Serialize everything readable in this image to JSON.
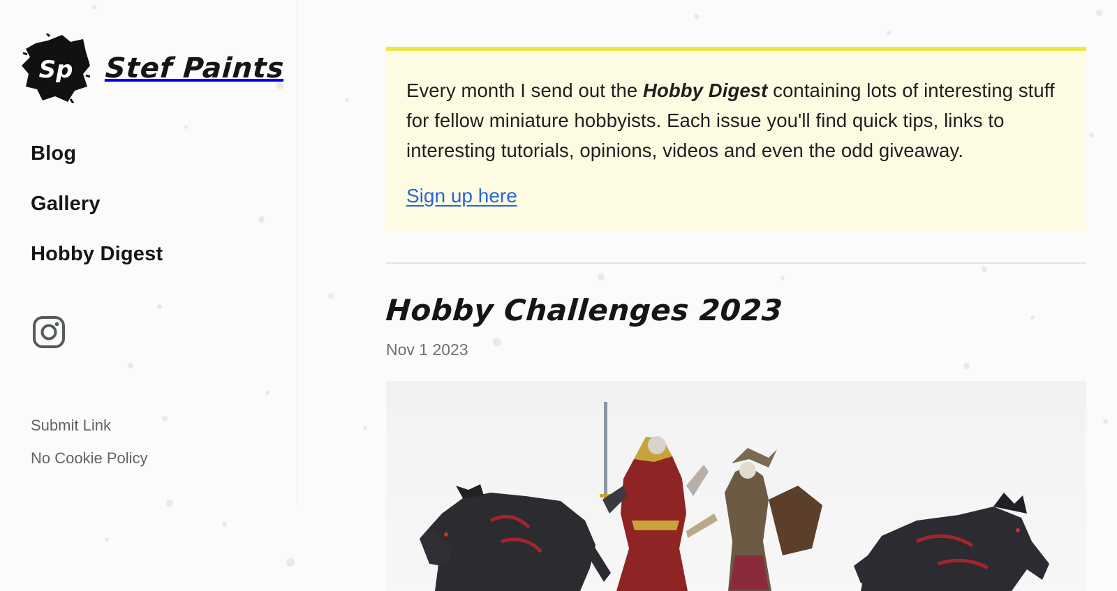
{
  "brand": {
    "logo_monogram": "Sp",
    "name": "Stef Paints"
  },
  "nav": {
    "items": [
      {
        "label": "Blog"
      },
      {
        "label": "Gallery"
      },
      {
        "label": "Hobby Digest"
      }
    ]
  },
  "social": {
    "icon": "instagram-icon"
  },
  "footer_links": {
    "submit": "Submit Link",
    "cookie": "No Cookie Policy"
  },
  "digest_box": {
    "text_before": "Every month I send out the ",
    "emphasis": "Hobby Digest",
    "text_after": " containing lots of interesting stuff for fellow miniature hobbyists. Each issue you'll find quick tips, links to interesting tutorials, opinions, videos and even the odd giveaway.",
    "link": "Sign up here",
    "accent_color": "#f1e54b",
    "background_color": "#fefbe3",
    "link_color": "#2667d9"
  },
  "post": {
    "title": "Hobby Challenges 2023",
    "date": "Nov 1 2023",
    "image_alt": "Painted miniatures: two wolves, a vampire knight and a skeleton warrior"
  }
}
